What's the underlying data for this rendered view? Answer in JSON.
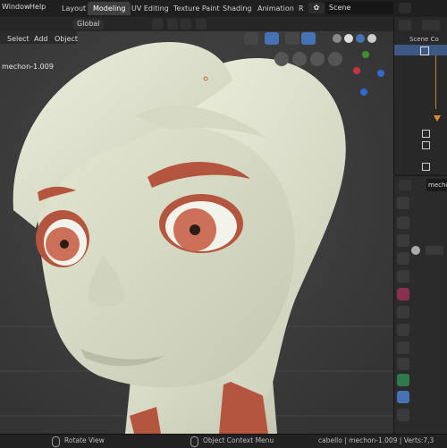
{
  "topbar": {
    "menus": [
      "Window",
      "Help"
    ],
    "workspaces": [
      "Layout",
      "Modeling",
      "UV Editing",
      "Texture Paint",
      "Shading",
      "Animation",
      "R"
    ],
    "active_workspace": "Modeling",
    "scene_label": "Scene"
  },
  "viewport_header": {
    "orientation": "Global",
    "menus": [
      "Select",
      "Add",
      "Object"
    ],
    "object_name": "mechon-1.009"
  },
  "outliner": {
    "title": "Scene Co"
  },
  "properties": {
    "object_name": "mecho"
  },
  "statusbar": {
    "left": "Rotate View",
    "middle": "Object Context Menu",
    "right": "cabello | mechon-1.009 | Verts:7,3"
  },
  "colors": {
    "accent": "#4772b3",
    "skin": "#d8dbc6",
    "lips_brows": "#b4563f"
  }
}
